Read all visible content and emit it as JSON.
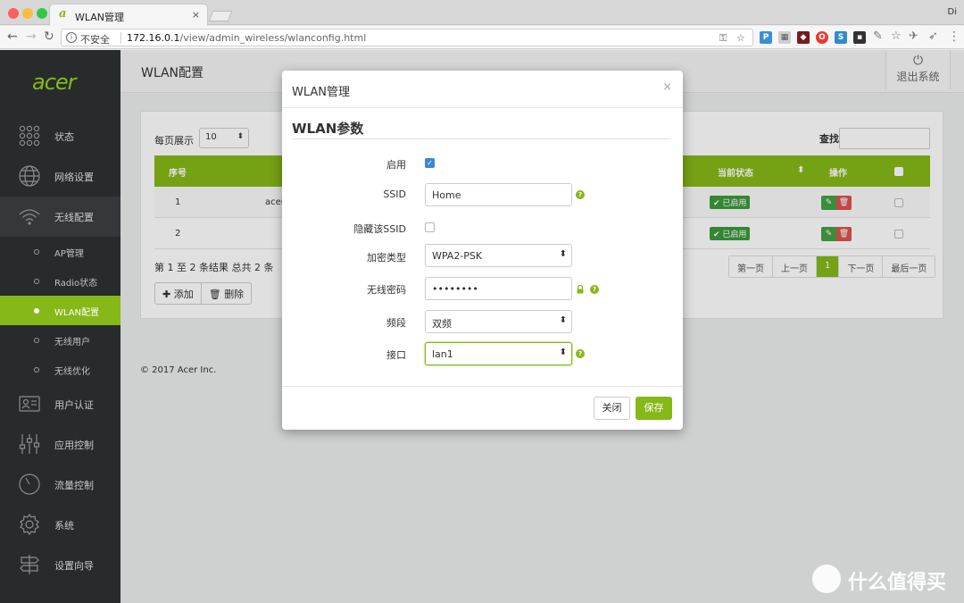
{
  "browser": {
    "tab_title": "WLAN管理",
    "tab_close": "×",
    "user_initials": "Di",
    "security_label": "不安全",
    "url_host": "172.16.0.1",
    "url_path": "/view/admin_wireless/wlanconfig.html",
    "colors": {
      "close": "#fc605c",
      "minimize": "#fdbc40",
      "maximize": "#34c84a"
    }
  },
  "sidebar": {
    "logo": "acer",
    "items": [
      {
        "label": "状态",
        "icon": "status-grid-icon"
      },
      {
        "label": "网络设置",
        "icon": "globe-icon"
      },
      {
        "label": "无线配置",
        "icon": "wifi-icon"
      },
      {
        "label": "用户认证",
        "icon": "id-card-icon"
      },
      {
        "label": "应用控制",
        "icon": "sliders-icon"
      },
      {
        "label": "流量控制",
        "icon": "gauge-icon"
      },
      {
        "label": "系统",
        "icon": "gear-icon"
      },
      {
        "label": "设置向导",
        "icon": "signpost-icon"
      }
    ],
    "subitems": [
      {
        "label": "AP管理"
      },
      {
        "label": "Radio状态"
      },
      {
        "label": "WLAN配置"
      },
      {
        "label": "无线用户"
      },
      {
        "label": "无线优化"
      }
    ]
  },
  "header": {
    "title": "WLAN配置",
    "logout_label": "退出系统"
  },
  "table": {
    "per_page_label": "每页展示",
    "per_page_value": "10",
    "search_label": "查找",
    "columns": {
      "index": "序号",
      "status": "当前状态",
      "ops": "操作"
    },
    "rows": [
      {
        "index": "1",
        "name": "acer_",
        "status": "已启用"
      },
      {
        "index": "2",
        "name": "",
        "status": "已启用"
      }
    ],
    "summary": "第 1 至 2 条结果   总共 2 条",
    "add_label": "添加",
    "delete_label": "删除",
    "pagination": {
      "first": "第一页",
      "prev": "上一页",
      "current": "1",
      "next": "下一页",
      "last": "最后一页"
    }
  },
  "footer": {
    "copyright": "© 2017 Acer Inc."
  },
  "modal": {
    "title": "WLAN管理",
    "close": "×",
    "section": "WLAN参数",
    "fields": {
      "enable_label": "启用",
      "enable_checked": true,
      "ssid_label": "SSID",
      "ssid_value": "Home",
      "hide_ssid_label": "隐藏该SSID",
      "hide_ssid_checked": false,
      "encryption_label": "加密类型",
      "encryption_value": "WPA2-PSK",
      "password_label": "无线密码",
      "password_value": "••••••••",
      "band_label": "频段",
      "band_value": "双频",
      "interface_label": "接口",
      "interface_value": "lan1"
    },
    "close_button": "关闭",
    "save_button": "保存"
  },
  "watermark": {
    "text": "什么值得买"
  },
  "colors": {
    "accent": "#86b817",
    "sidebar": "#282b2c",
    "danger": "#d9534f",
    "success": "#3b9a3b"
  }
}
